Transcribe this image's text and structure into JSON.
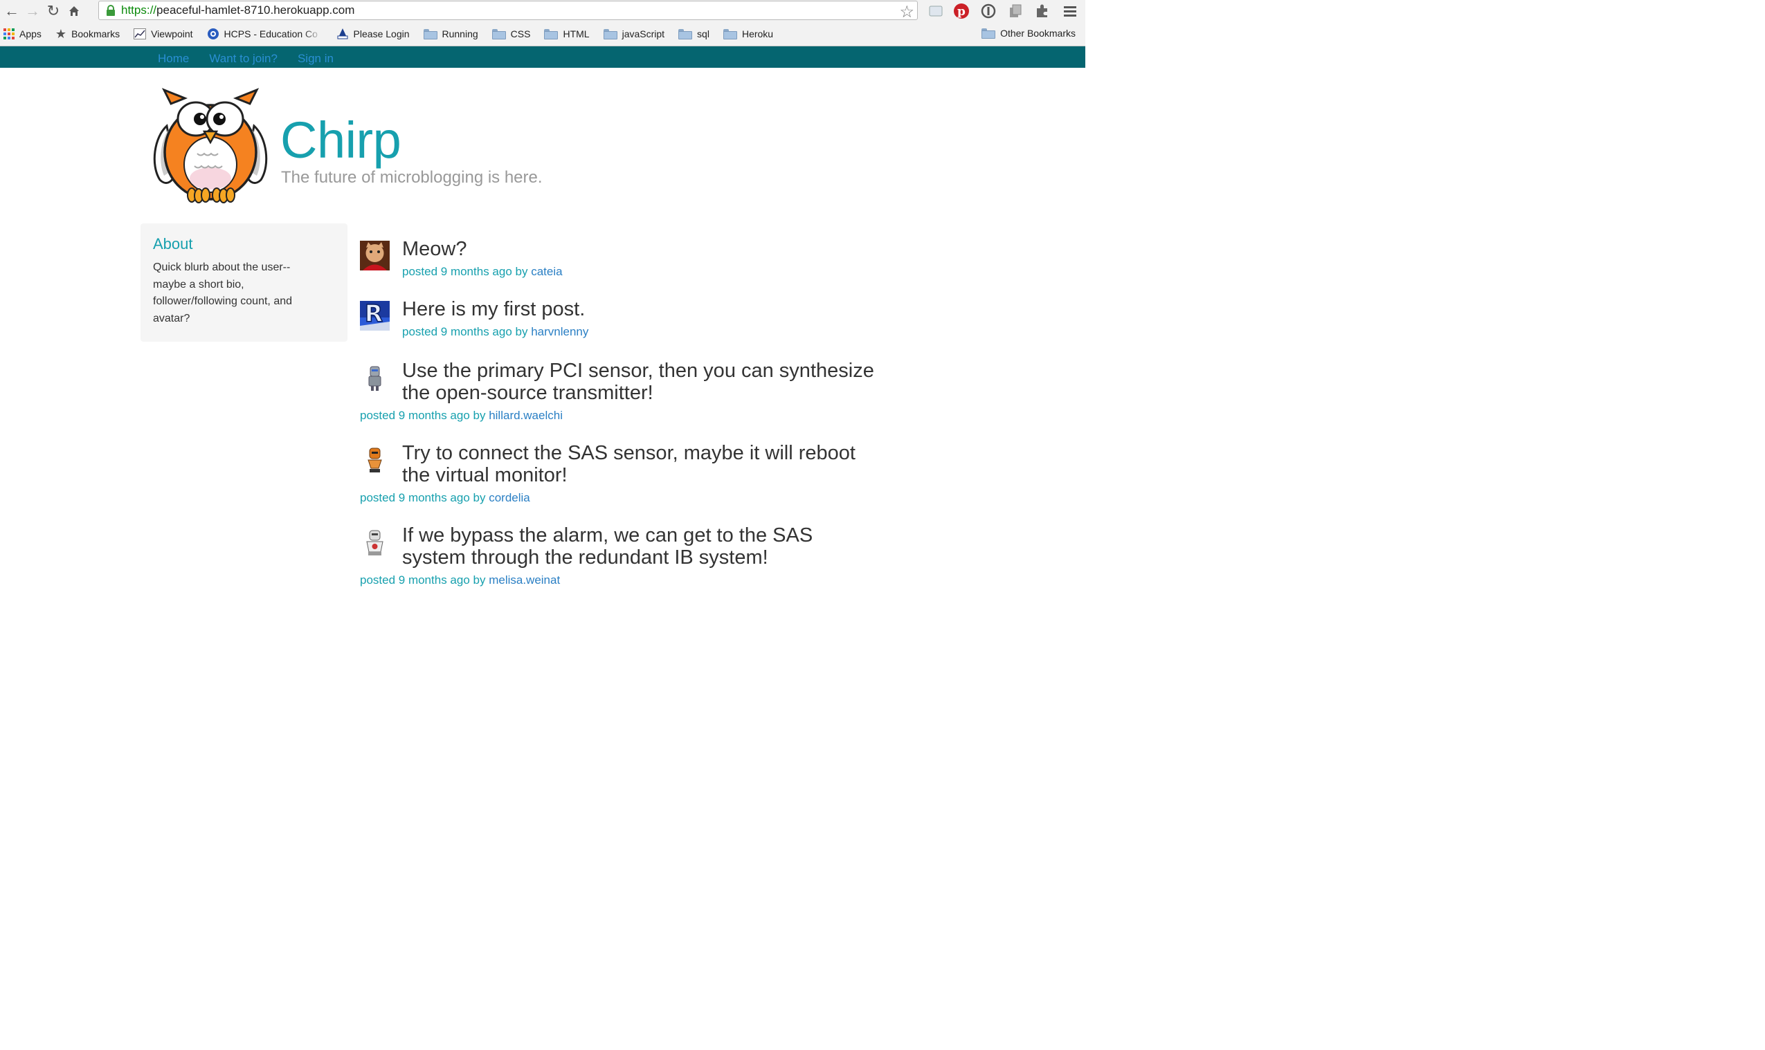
{
  "browser": {
    "url_scheme": "https://",
    "url_host": "peaceful-hamlet-8710.herokuapp.com",
    "bookmarks": [
      {
        "label": "Apps",
        "icon": "apps-grid-icon"
      },
      {
        "label": "Bookmarks",
        "icon": "star-icon"
      },
      {
        "label": "Viewpoint",
        "icon": "viewpoint-icon"
      },
      {
        "label": "HCPS - Education Co",
        "icon": "hcps-icon"
      },
      {
        "label": "Please Login",
        "icon": "login-icon"
      },
      {
        "label": "Running",
        "icon": "folder-icon"
      },
      {
        "label": "CSS",
        "icon": "folder-icon"
      },
      {
        "label": "HTML",
        "icon": "folder-icon"
      },
      {
        "label": "javaScript",
        "icon": "folder-icon"
      },
      {
        "label": "sql",
        "icon": "folder-icon"
      },
      {
        "label": "Heroku",
        "icon": "folder-icon"
      }
    ],
    "other_bookmarks": "Other Bookmarks"
  },
  "nav": {
    "items": [
      "Home",
      "Want to join?",
      "Sign in"
    ]
  },
  "header": {
    "title": "Chirp",
    "tagline": "The future of microblogging is here."
  },
  "sidebar": {
    "heading": "About",
    "lines": [
      "Quick blurb about the user--",
      "maybe a short bio,",
      "follower/following count, and",
      "avatar?"
    ]
  },
  "posts": [
    {
      "text": [
        "Meow?"
      ],
      "meta": "posted 9 months ago by",
      "user": "cateia",
      "avatar": "cat-avatar"
    },
    {
      "text": [
        "Here is my first post."
      ],
      "meta": "posted 9 months ago by",
      "user": "harvnlenny",
      "avatar": "letter-r-avatar"
    },
    {
      "text": [
        "Use the primary PCI sensor, then you can synthesize",
        "the open-source transmitter!"
      ],
      "meta": "posted 9 months ago by",
      "user": "hillard.waelchi",
      "avatar": "robot-avatar"
    },
    {
      "text": [
        "Try to connect the SAS sensor, maybe it will reboot",
        "the virtual monitor!"
      ],
      "meta": "posted 9 months ago by",
      "user": "cordelia",
      "avatar": "robot-avatar"
    },
    {
      "text": [
        "If we bypass the alarm, we can get to the SAS",
        "system through the redundant IB system!"
      ],
      "meta": "posted 9 months ago by",
      "user": "melisa.weinat",
      "avatar": "robot-avatar"
    }
  ],
  "colors": {
    "nav_bg": "#056570",
    "accent": "#17a0ae",
    "link": "#2a7fc4"
  }
}
